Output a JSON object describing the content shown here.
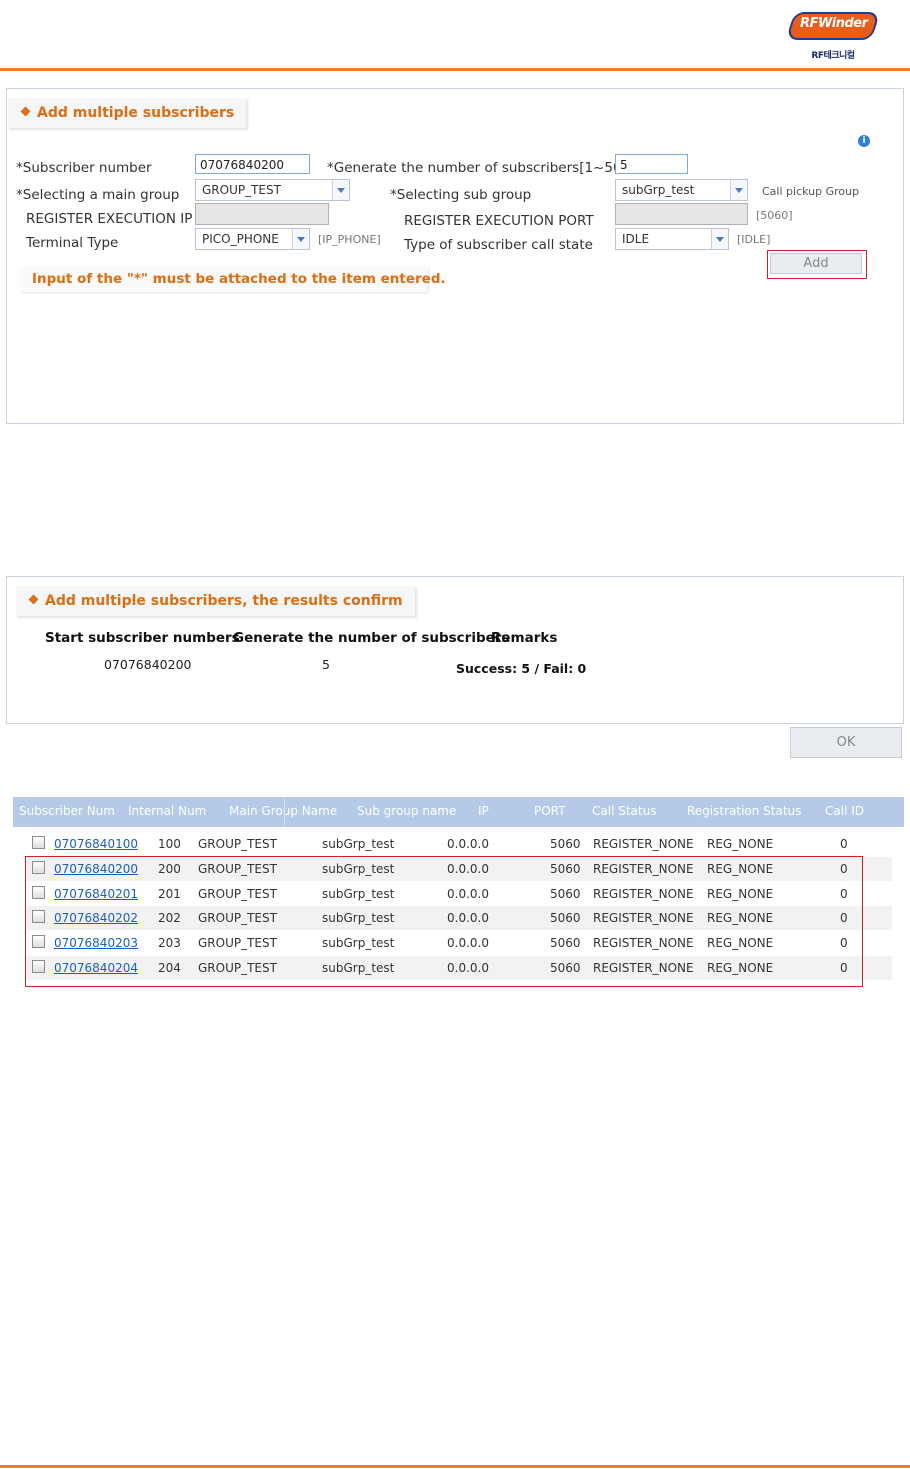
{
  "header": {
    "logo_text": "RFWinder",
    "logo_sub": "RF테크니컬",
    "accent": "#f07a2a"
  },
  "add_panel": {
    "title": "Add multiple subscribers",
    "subscriber_number_label": "*Subscriber number",
    "subscriber_number_value": "07076840200",
    "generate_label": "*Generate the number of subscribers[1~50]",
    "generate_value": "5",
    "main_group_label": "*Selecting a main group",
    "main_group_value": "GROUP_TEST",
    "sub_group_label": "*Selecting sub group",
    "sub_group_value": "subGrp_test",
    "call_pickup_label": "Call pickup Group",
    "reg_ip_label": "REGISTER EXECUTION IP",
    "reg_port_label": "REGISTER EXECUTION PORT",
    "reg_port_hint": "[5060]",
    "terminal_type_label": "Terminal Type",
    "terminal_type_value": "PICO_PHONE",
    "terminal_type_hint": "[IP_PHONE]",
    "call_state_label": "Type of subscriber call state",
    "call_state_value": "IDLE",
    "call_state_hint": "[IDLE]",
    "warning": "Input of the \"*\" must be attached to the item entered.",
    "add_button": "Add",
    "info_icon": "i"
  },
  "result_panel": {
    "title": "Add multiple subscribers, the results confirm",
    "col_start": "Start subscriber numbers",
    "col_generate": "Generate the number of subscribers",
    "col_remarks": "Remarks",
    "start_value": "07076840200",
    "generate_value": "5",
    "remarks_value": "Success: 5 / Fail: 0",
    "ok_button": "OK"
  },
  "table": {
    "columns": [
      "Subscriber Num",
      "Internal Num",
      "Main Group Name",
      "Sub group name",
      "IP",
      "PORT",
      "Call Status",
      "Registration Status",
      "Call ID"
    ],
    "rows": [
      [
        "07076840100",
        "100",
        "GROUP_TEST",
        "subGrp_test",
        "0.0.0.0",
        "5060",
        "REGISTER_NONE",
        "REG_NONE",
        "0"
      ],
      [
        "07076840200",
        "200",
        "GROUP_TEST",
        "subGrp_test",
        "0.0.0.0",
        "5060",
        "REGISTER_NONE",
        "REG_NONE",
        "0"
      ],
      [
        "07076840201",
        "201",
        "GROUP_TEST",
        "subGrp_test",
        "0.0.0.0",
        "5060",
        "REGISTER_NONE",
        "REG_NONE",
        "0"
      ],
      [
        "07076840202",
        "202",
        "GROUP_TEST",
        "subGrp_test",
        "0.0.0.0",
        "5060",
        "REGISTER_NONE",
        "REG_NONE",
        "0"
      ],
      [
        "07076840203",
        "203",
        "GROUP_TEST",
        "subGrp_test",
        "0.0.0.0",
        "5060",
        "REGISTER_NONE",
        "REG_NONE",
        "0"
      ],
      [
        "07076840204",
        "204",
        "GROUP_TEST",
        "subGrp_test",
        "0.0.0.0",
        "5060",
        "REGISTER_NONE",
        "REG_NONE",
        "0"
      ]
    ]
  }
}
